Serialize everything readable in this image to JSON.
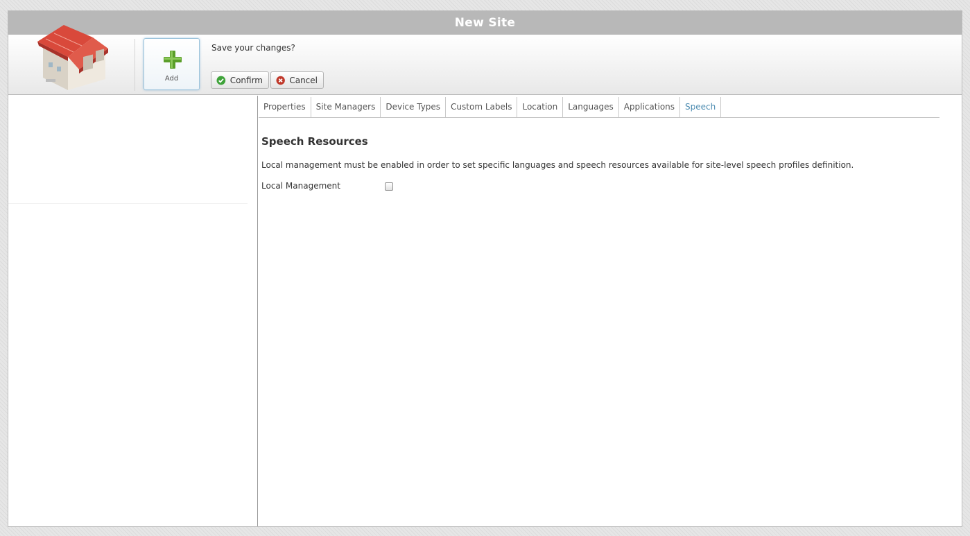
{
  "window": {
    "title": "New Site"
  },
  "toolbar": {
    "logo_icon": "warehouse-building-icon",
    "add_label": "Add",
    "add_icon": "green-plus-icon",
    "save_prompt": "Save your changes?",
    "confirm_label": "Confirm",
    "confirm_icon": "green-check-icon",
    "cancel_label": "Cancel",
    "cancel_icon": "red-x-icon"
  },
  "tabs": [
    {
      "label": "Properties",
      "active": false
    },
    {
      "label": "Site Managers",
      "active": false
    },
    {
      "label": "Device Types",
      "active": false
    },
    {
      "label": "Custom Labels",
      "active": false
    },
    {
      "label": "Location",
      "active": false
    },
    {
      "label": "Languages",
      "active": false
    },
    {
      "label": "Applications",
      "active": false
    },
    {
      "label": "Speech",
      "active": true
    }
  ],
  "speech": {
    "title": "Speech Resources",
    "description": "Local management must be enabled in order to set specific languages and speech resources available for site-level speech profiles definition.",
    "local_management_label": "Local Management",
    "local_management_checked": false
  },
  "colors": {
    "titlebar": "#b8b8b8",
    "active_tab": "#4b8bb0",
    "add_plus": "#5a9e2a",
    "confirm_icon": "#3fa33a",
    "cancel_icon": "#c0392b",
    "roof": "#d9493b"
  }
}
